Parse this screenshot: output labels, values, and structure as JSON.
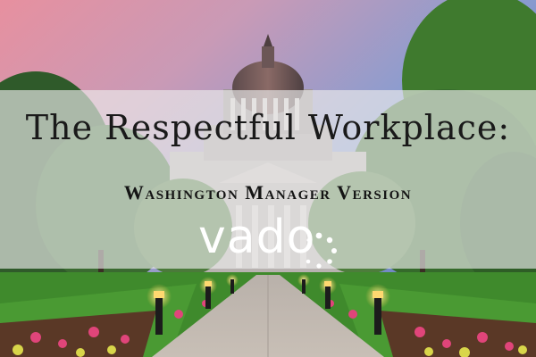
{
  "slide": {
    "title": "The Respectful Workplace:",
    "subtitle": "Washington Manager Version",
    "logo_text": "vado"
  },
  "colors": {
    "sky_top": "#9aa6d6",
    "sky_pink": "#e79aa8",
    "lawn": "#3f8a2c",
    "banner": "#ebebeb",
    "text": "#1a1a1a"
  }
}
